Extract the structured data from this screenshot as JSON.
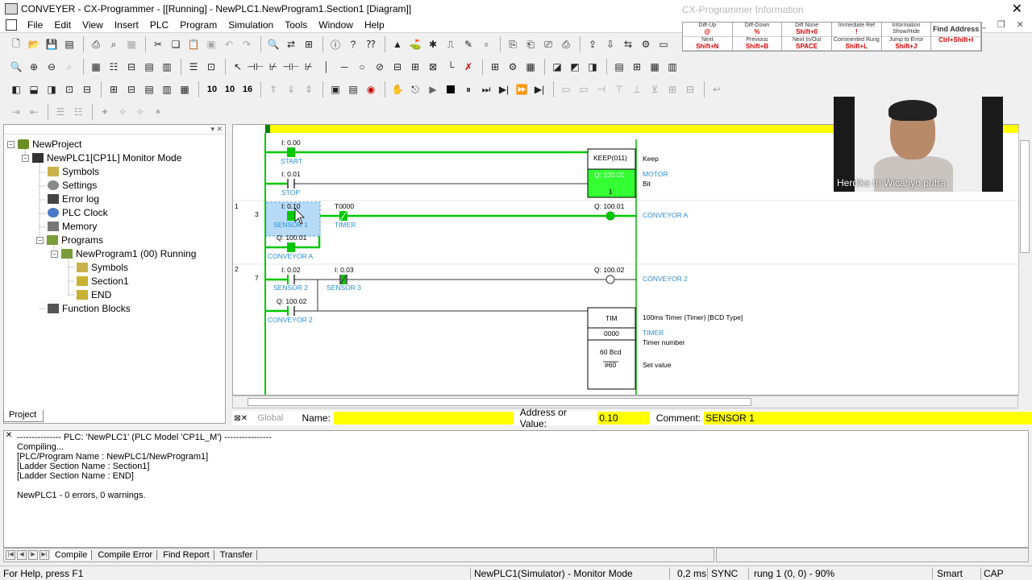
{
  "window": {
    "title": "CONVEYER - CX-Programmer - [[Running] - NewPLC1.NewProgram1.Section1 [Diagram]]"
  },
  "menu": [
    "File",
    "Edit",
    "View",
    "Insert",
    "PLC",
    "Program",
    "Simulation",
    "Tools",
    "Window",
    "Help"
  ],
  "info_panel": {
    "title": "CX-Programmer Information",
    "cells": [
      {
        "top": "Diff-Up",
        "key": "@"
      },
      {
        "top": "Diff-Down",
        "key": "%"
      },
      {
        "top": "Diff None",
        "key": "Shift+0"
      },
      {
        "top": "Immediate Ref",
        "key": "!"
      },
      {
        "top": "Information",
        "key": "Show/Hide"
      },
      {
        "top": "",
        "key": ""
      },
      {
        "top": "Next",
        "key": "Shift+N"
      },
      {
        "top": "Previous",
        "key": "Shift+B"
      },
      {
        "top": "Next In/Out",
        "key": "SPACE"
      },
      {
        "top": "Commented Rung",
        "key": "Shift+L"
      },
      {
        "top": "Jump to Error",
        "key": "Shift+J"
      },
      {
        "top": "",
        "key": "Ctrl+Shift+I"
      }
    ],
    "overlay_text": "Find Address"
  },
  "toolbar3_numbers": [
    "10",
    "10",
    "16"
  ],
  "project_tree": [
    {
      "label": "NewProject",
      "icon": "project-icon",
      "expand": "−"
    },
    {
      "label": "NewPLC1[CP1L] Monitor Mode",
      "icon": "plc-icon",
      "expand": "−"
    },
    {
      "label": "Symbols",
      "icon": "symbols-icon",
      "expand": ""
    },
    {
      "label": "Settings",
      "icon": "settings-icon",
      "expand": ""
    },
    {
      "label": "Error log",
      "icon": "error-log-icon",
      "expand": ""
    },
    {
      "label": "PLC Clock",
      "icon": "clock-icon",
      "expand": ""
    },
    {
      "label": "Memory",
      "icon": "memory-icon",
      "expand": ""
    },
    {
      "label": "Programs",
      "icon": "programs-icon",
      "expand": "−"
    },
    {
      "label": "NewProgram1 (00) Running",
      "icon": "program-icon",
      "expand": "−"
    },
    {
      "label": "Symbols",
      "icon": "symbols-icon",
      "expand": ""
    },
    {
      "label": "Section1",
      "icon": "section-icon",
      "expand": ""
    },
    {
      "label": "END",
      "icon": "section-icon",
      "expand": ""
    },
    {
      "label": "Function Blocks",
      "icon": "function-blocks-icon",
      "expand": ""
    }
  ],
  "project_tab": "Project",
  "ladder": {
    "rung_numbers": [
      {
        "index": "1",
        "address": "3"
      },
      {
        "index": "2",
        "address": "7"
      }
    ],
    "contacts": [
      {
        "addr": "I: 0.00",
        "comment": "START"
      },
      {
        "addr": "I: 0.01",
        "comment": "STOP"
      },
      {
        "addr": "I: 0.10",
        "comment": "SENSOR 1"
      },
      {
        "addr": "T0000",
        "comment": "TIMER"
      },
      {
        "addr": "Q: 100.01",
        "comment": "CONVEYOR A"
      },
      {
        "addr": "I: 0.02",
        "comment": "SENSOR 2"
      },
      {
        "addr": "I: 0.03",
        "comment": "SENSOR 3"
      },
      {
        "addr": "Q: 100.02",
        "comment": "CONVEYOR 2"
      }
    ],
    "keep": {
      "name": "KEEP(011)",
      "addr": "Q: 100.00",
      "value": "1",
      "desc": "Keep",
      "op": "MOTOR",
      "op_desc": "Bit"
    },
    "coils": [
      {
        "addr": "Q: 100.01",
        "comment": "CONVEYOR A"
      },
      {
        "addr": "Q: 100.02",
        "comment": "CONVEYOR 2"
      }
    ],
    "tim": {
      "name": "TIM",
      "num": "0000",
      "pv": "60 Bcd",
      "sv": "#60",
      "desc": "100ms Timer (Timer) [BCD Type]",
      "op": "TIMER",
      "op_desc": "Timer number",
      "sv_desc": "Set value"
    },
    "energized_color": "#00c800",
    "highlight_color": "#ffff00"
  },
  "namebar": {
    "global": "Global",
    "name_label": "Name:",
    "name_value": "",
    "address_label": "Address or Value:",
    "address_value": "0.10",
    "comment_label": "Comment:",
    "comment_value": "SENSOR 1"
  },
  "output": {
    "lines": [
      "--------------- PLC: 'NewPLC1' (PLC Model 'CP1L_M') ----------------",
      "Compiling...",
      "[PLC/Program Name : NewPLC1/NewProgram1]",
      "[Ladder Section Name : Section1]",
      "[Ladder Section Name : END]",
      "",
      "NewPLC1 - 0 errors, 0 warnings."
    ],
    "tabs": [
      "Compile",
      "Compile Error",
      "Find Report",
      "Transfer"
    ]
  },
  "status": {
    "help": "For Help, press F1",
    "mode": "NewPLC1(Simulator) - Monitor Mode",
    "cycle": "0,2 ms",
    "sync": "SYNC",
    "rung": "rung 1 (0, 0)  - 90%",
    "smart": "Smart",
    "caps": "CAP"
  },
  "webcam": {
    "name": "Herdika tri Wicahyo putra"
  }
}
